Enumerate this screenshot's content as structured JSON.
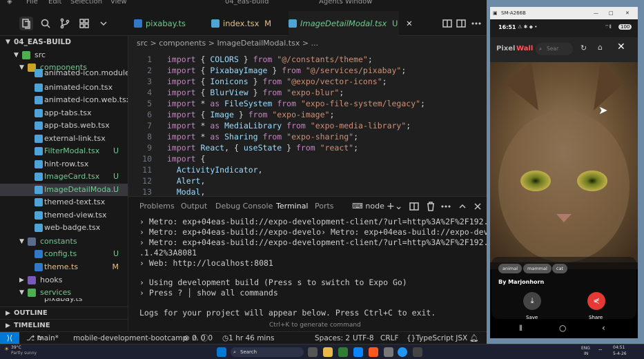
{
  "vscode": {
    "menu": [
      "File",
      "Edit",
      "Selection",
      "View"
    ],
    "window_title": "04_eas-build",
    "agents_window": "Agents Window",
    "tabs": [
      {
        "label": "pixabay.ts",
        "badge": "U"
      },
      {
        "label": "index.tsx",
        "badge": "M"
      },
      {
        "label": "ImageDetailModal.tsx",
        "badge": "U"
      }
    ],
    "breadcrumb": "src > components > ImageDetailModal.tsx > ...",
    "explorer": {
      "root": "04_EAS-BUILD",
      "items": [
        {
          "label": "src",
          "type": "folder"
        },
        {
          "label": "components",
          "type": "folder"
        },
        {
          "label": "animated-icon.module.css",
          "type": "file"
        },
        {
          "label": "animated-icon.tsx",
          "type": "file"
        },
        {
          "label": "animated-icon.web.tsx",
          "type": "file"
        },
        {
          "label": "app-tabs.tsx",
          "type": "file"
        },
        {
          "label": "app-tabs.web.tsx",
          "type": "file"
        },
        {
          "label": "external-link.tsx",
          "type": "file"
        },
        {
          "label": "FilterModal.tsx",
          "type": "file",
          "badge": "U"
        },
        {
          "label": "hint-row.tsx",
          "type": "file"
        },
        {
          "label": "ImageCard.tsx",
          "type": "file",
          "badge": "U"
        },
        {
          "label": "ImageDetailModa...",
          "type": "file",
          "badge": "U"
        },
        {
          "label": "themed-text.tsx",
          "type": "file"
        },
        {
          "label": "themed-view.tsx",
          "type": "file"
        },
        {
          "label": "web-badge.tsx",
          "type": "file"
        },
        {
          "label": "constants",
          "type": "folder"
        },
        {
          "label": "config.ts",
          "type": "file",
          "badge": "U"
        },
        {
          "label": "theme.ts",
          "type": "file",
          "badge": "M"
        },
        {
          "label": "hooks",
          "type": "folder"
        },
        {
          "label": "services",
          "type": "folder"
        },
        {
          "label": "pixabay.ts",
          "type": "file"
        }
      ],
      "outline": "OUTLINE",
      "timeline": "TIMELINE"
    },
    "code_lines": [
      {
        "n": "1",
        "text": "import { COLORS } from \"@/constants/theme\";"
      },
      {
        "n": "2",
        "text": "import { PixabayImage } from \"@/services/pixabay\";"
      },
      {
        "n": "3",
        "text": "import { Ionicons } from \"@expo/vector-icons\";"
      },
      {
        "n": "4",
        "text": "import { BlurView } from \"expo-blur\";"
      },
      {
        "n": "5",
        "text": "import * as FileSystem from \"expo-file-system/legacy\";"
      },
      {
        "n": "6",
        "text": "import { Image } from \"expo-image\";"
      },
      {
        "n": "7",
        "text": "import * as MediaLibrary from \"expo-media-library\";"
      },
      {
        "n": "8",
        "text": "import * as Sharing from \"expo-sharing\";"
      },
      {
        "n": "9",
        "text": "import React, { useState } from \"react\";"
      },
      {
        "n": "10",
        "text": "import {"
      },
      {
        "n": "11",
        "text": "  ActivityIndicator,"
      },
      {
        "n": "12",
        "text": "  Alert,"
      },
      {
        "n": "13",
        "text": "  Modal,"
      }
    ],
    "panel_tabs": [
      "Problems",
      "Output",
      "Debug Console",
      "Terminal",
      "Ports"
    ],
    "terminal_name": "node",
    "terminal_lines": [
      "› Metro: exp+04eas-build://expo-development-client/?url=http%3A%2F%2F192.168",
      "› Metro: exp+04eas-build://expo-develo› Metro: exp+04eas-build://expo-develo",
      "› Metro: exp+04eas-build://expo-development-client/?url=http%3A%2F%2F192.168",
      ".1.42%3A8081",
      "› Web: http://localhost:8081",
      "",
      "› Using development build (Press s to switch to Expo Go)",
      "› Press ? │ show all commands",
      "",
      "Logs for your project will appear below. Press Ctrl+C to exit."
    ],
    "terminal_hint": "Ctrl+K to generate command",
    "status": {
      "branch": "main*",
      "project": "mobile-development-bootcamp",
      "errors": "0",
      "warnings": "0",
      "info": "0",
      "time": "1 hr 46 mins",
      "spaces": "Spaces: 2",
      "encoding": "UTF-8",
      "eol": "CRLF",
      "language": "TypeScript JSX"
    }
  },
  "taskbar": {
    "weather_temp": "39°C",
    "weather_desc": "Partly sunny",
    "search_placeholder": "Search",
    "lang": "ENG",
    "region": "IN",
    "clock_time": "04:51",
    "clock_date": "5-4-26"
  },
  "phone": {
    "device_name": "SM-A266B",
    "time": "16:51",
    "battery": "100",
    "app_name_a": "Pixel",
    "app_name_b": "Wall",
    "search_placeholder": "Sear",
    "tags": [
      "animal",
      "mammal",
      "cat"
    ],
    "author": "By Marjonhorn",
    "save_label": "Save",
    "share_label": "Share",
    "colors": {
      "accent": "#e53935",
      "brand_red": "#ff5555"
    }
  }
}
